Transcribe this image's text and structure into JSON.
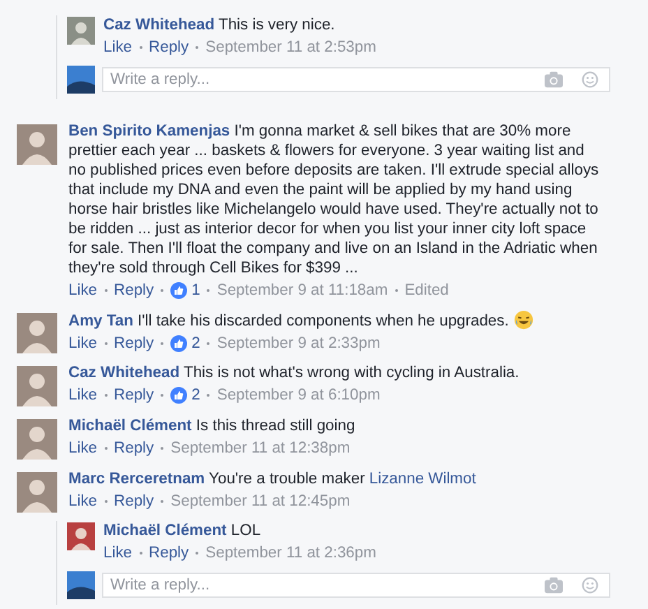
{
  "top_thread": {
    "replies": [
      {
        "author": "Caz Whitehead",
        "text": "This is very nice.",
        "actions": [
          "Like",
          "Reply"
        ],
        "meta": [
          "September 11 at 2:53pm"
        ]
      }
    ],
    "reply_box": {
      "placeholder": "Write a reply..."
    }
  },
  "comments": [
    {
      "author": "Ben Spirito Kamenjas",
      "text": "I'm gonna market & sell bikes that are 30% more prettier each year ... baskets & flowers for everyone. 3 year waiting list and no published prices even before deposits are taken. I'll extrude special alloys that include my DNA and even the paint will be applied by my hand using horse hair bristles like Michelangelo would have used. They're actually not to be ridden ... just as interior decor for when you list your inner city loft space for sale. Then I'll float the company and live on an Island in the Adriatic when they're sold through Cell Bikes for $399 ...",
      "has_emoji": false,
      "actions": [
        "Like",
        "Reply"
      ],
      "likes": "1",
      "meta": [
        "September 9 at 11:18am",
        "Edited"
      ]
    },
    {
      "author": "Amy Tan",
      "text": "I'll take his discarded components when he upgrades.",
      "has_emoji": true,
      "actions": [
        "Like",
        "Reply"
      ],
      "likes": "2",
      "meta": [
        "September 9 at 2:33pm"
      ]
    },
    {
      "author": "Caz Whitehead",
      "text": "This is not what's wrong with cycling in Australia.",
      "has_emoji": false,
      "actions": [
        "Like",
        "Reply"
      ],
      "likes": "2",
      "meta": [
        "September 9 at 6:10pm"
      ]
    },
    {
      "author": "Michaël Clément",
      "text": "Is this thread still going",
      "has_emoji": false,
      "actions": [
        "Like",
        "Reply"
      ],
      "meta": [
        "September 11 at 12:38pm"
      ]
    },
    {
      "author": "Marc Rerceretnam",
      "text": "You're a trouble maker",
      "mention": "Lizanne Wilmot",
      "has_emoji": false,
      "actions": [
        "Like",
        "Reply"
      ],
      "meta": [
        "September 11 at 12:45pm"
      ],
      "thread": {
        "replies": [
          {
            "author": "Michaël Clément",
            "text": "LOL",
            "actions": [
              "Like",
              "Reply"
            ],
            "meta": [
              "September 11 at 2:36pm"
            ]
          }
        ],
        "reply_box": {
          "placeholder": "Write a reply..."
        }
      }
    }
  ]
}
